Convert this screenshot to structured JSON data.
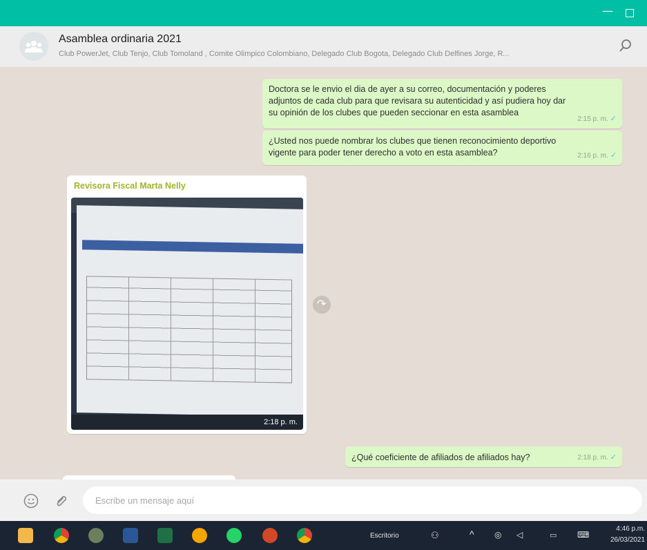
{
  "window": {
    "accent": "#00bfa5",
    "minimize_glyph": "—"
  },
  "header": {
    "title": "Asamblea ordinaria 2021",
    "subtitle": "Club PowerJet, Club Tenjo, Club Tomoland , Comite Olimpico Colombiano, Delegado Club Bogota, Delegado Club Delfines Jorge, R..."
  },
  "messages": [
    {
      "direction": "out",
      "text": "Doctora se le envio el dia de ayer a su correo, documentación y poderes adjuntos de cada club para que revisara su autenticidad y así pudiera hoy dar su opinión de los clubes que pueden seccionar en esta asamblea",
      "time": "2:15 p. m."
    },
    {
      "direction": "out",
      "text": "¿Usted nos puede nombrar los clubes que tienen reconocimiento deportivo vigente para poder tener derecho a voto en esta asamblea?",
      "time": "2:16 p. m."
    },
    {
      "direction": "in",
      "sender": "Revisora Fiscal Marta Nelly",
      "time": "2:18 p. m."
    },
    {
      "direction": "out",
      "text": "¿Qué coeficiente de afiliados de afiliados hay?",
      "time": "2:18 p. m."
    }
  ],
  "composer": {
    "placeholder": "Escribe un mensaje aquí"
  },
  "taskbar": {
    "desktop_label": "Escritorio",
    "clock_time": "4:46 p.m.",
    "clock_date": "26/03/2021"
  },
  "icons": {
    "search": "search-icon",
    "emoji": "emoji-icon",
    "attach": "paperclip-icon",
    "forward": "forward-icon",
    "check": "check-icon"
  }
}
